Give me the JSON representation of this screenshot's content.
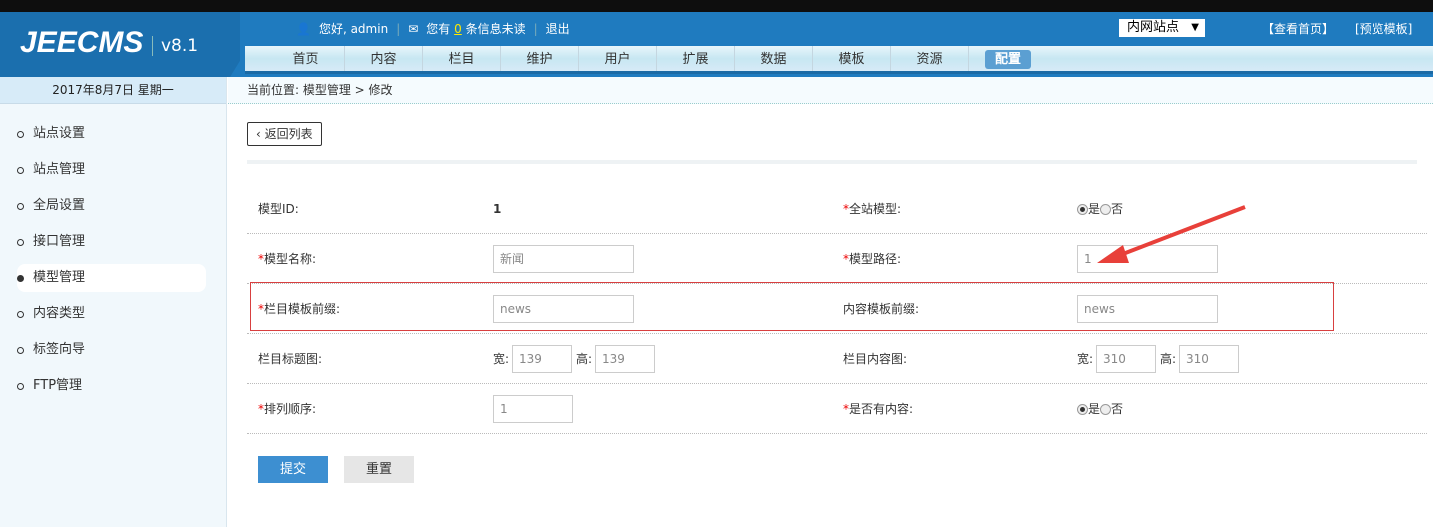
{
  "header": {
    "logo": "JEECMS",
    "version": "v8.1",
    "greeting": "您好, admin",
    "msg_prefix": "您有",
    "msg_count": "0",
    "msg_suffix": "条信息未读",
    "logout": "退出",
    "site_select": "内网站点",
    "view_home": "【查看首页】",
    "preview_template": "[预览模板]"
  },
  "nav": [
    "首页",
    "内容",
    "栏目",
    "维护",
    "用户",
    "扩展",
    "数据",
    "模板",
    "资源",
    "配置"
  ],
  "nav_active": "配置",
  "sidebar": {
    "date": "2017年8月7日 星期一",
    "items": [
      "站点设置",
      "站点管理",
      "全局设置",
      "接口管理",
      "模型管理",
      "内容类型",
      "标签向导",
      "FTP管理"
    ],
    "active": "模型管理"
  },
  "breadcrumb": "当前位置: 模型管理 > 修改",
  "back_label": "返回列表",
  "form": {
    "model_id_label": "模型ID:",
    "model_id": "1",
    "global_label": "全站模型:",
    "yes": "是",
    "no": "否",
    "name_label": "模型名称:",
    "name": "新闻",
    "path_label": "模型路径:",
    "path": "1",
    "channel_prefix_label": "栏目模板前缀:",
    "channel_prefix": "news",
    "content_prefix_label": "内容模板前缀:",
    "content_prefix": "news",
    "channel_title_img_label": "栏目标题图:",
    "width_label": "宽:",
    "height_label": "高:",
    "channel_title_w": "139",
    "channel_title_h": "139",
    "channel_content_img_label": "栏目内容图:",
    "channel_content_w": "310",
    "channel_content_h": "310",
    "order_label": "排列顺序:",
    "order": "1",
    "has_content_label": "是否有内容:"
  },
  "buttons": {
    "submit": "提交",
    "reset": "重置"
  },
  "colors": {
    "header": "#1f7bbf",
    "accent": "#3d8fd1",
    "required": "#e00000",
    "annotation": "#e8403a"
  }
}
